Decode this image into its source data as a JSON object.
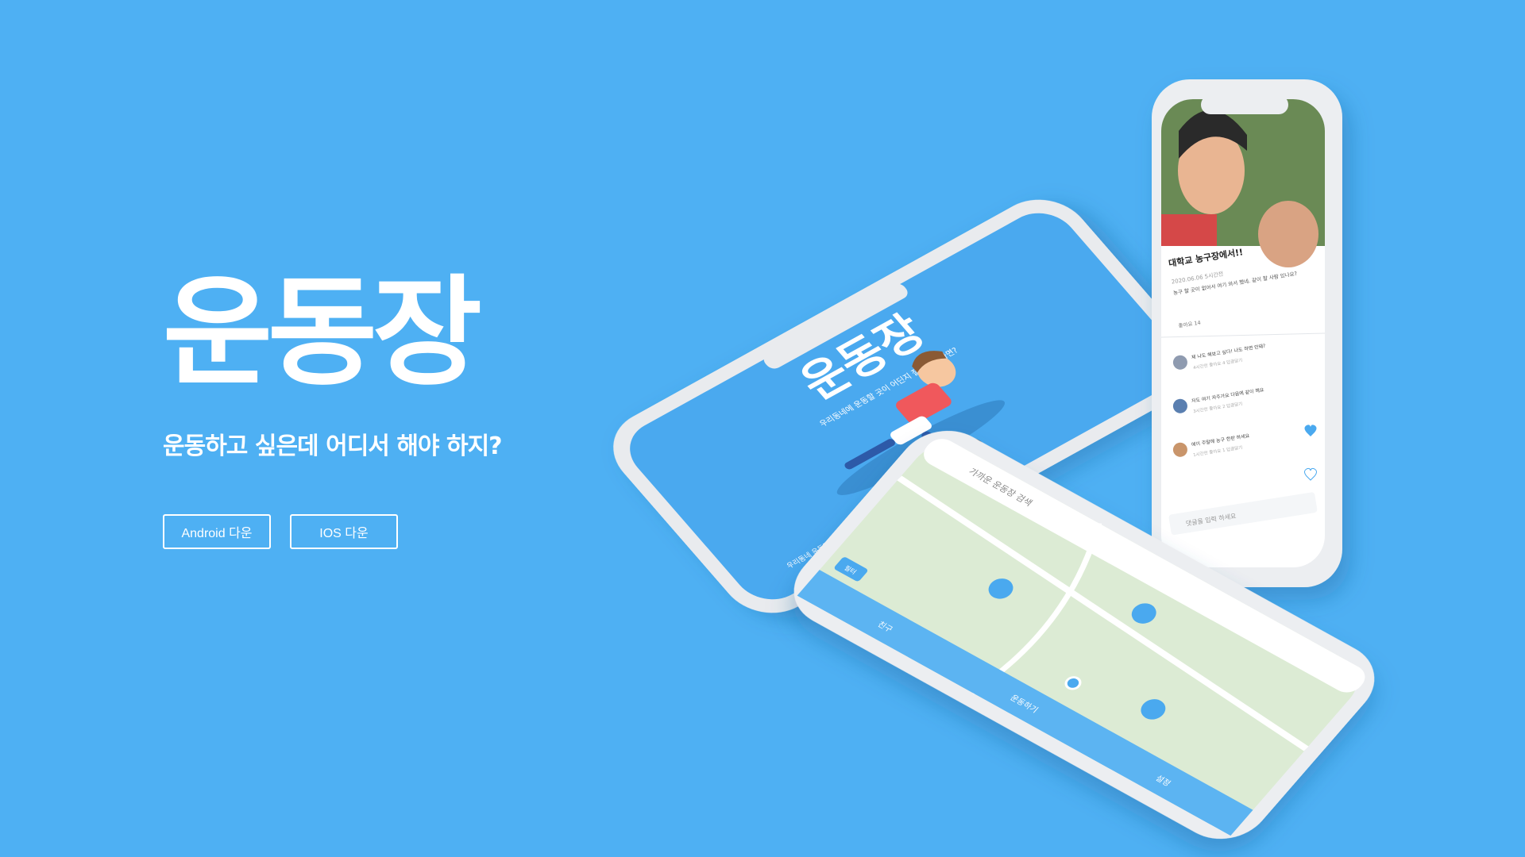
{
  "colors": {
    "background": "#4eb0f3",
    "phone_body": "#eceef1",
    "screen_blue": "#4aa9ef",
    "map_green": "#dcebd4"
  },
  "hero": {
    "logo": "운동장",
    "tagline": "운동하고 싶은데 어디서 해야 하지?",
    "buttons": [
      "Android 다운",
      "IOS 다운"
    ]
  },
  "splash_phone": {
    "logo": "운동장",
    "subtitle": "우리동네에 운동할 곳이 어딘지 잘 모르겠다면?",
    "bottom_text": "우리동네 운동장에서 놀자!"
  },
  "feed_phone": {
    "post_title": "대학교 농구장에서!!",
    "post_date": "2020.06.06  5시간전",
    "post_body": "농구 할 곳이 없어서 여기 와서 했네. 같이 할 사람 있나요?",
    "likes": "좋아요 14",
    "comments": [
      {
        "text": "제 나도 해보고 싶다! 나도 하면 안돼?",
        "meta": "4시간전  좋아요 4  답글달기"
      },
      {
        "text": "저도 여기 자주가요 다음에 같이 해요",
        "meta": "3시간전  좋아요 2  답글달기"
      },
      {
        "text": "에이 주말에 농구 한판 하세요",
        "meta": "1시간전  좋아요 1  답글달기"
      }
    ],
    "comment_placeholder": "댓글을 입력 하세요"
  },
  "map_phone": {
    "search_placeholder": "가까운 운동장 검색",
    "nav": [
      "친구",
      "운동하기",
      "설정"
    ],
    "filter_label": "필터"
  }
}
